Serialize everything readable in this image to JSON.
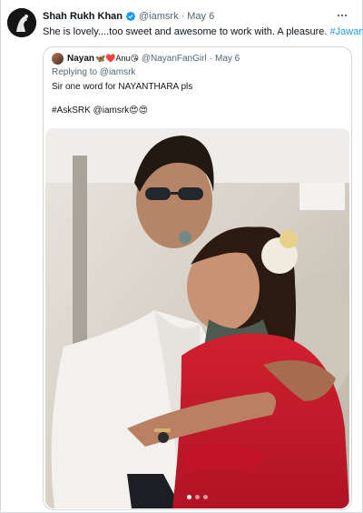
{
  "tweet": {
    "author_name": "Shah Rukh Khan",
    "author_handle": "@iamsrk",
    "separator": "·",
    "date": "May 6",
    "text": "She is lovely....too sweet and awesome to work with. A pleasure. ",
    "hashtag": "#Jawan",
    "more_icon": "more-horizontal-icon",
    "verified_icon": "verified-badge-icon"
  },
  "quoted": {
    "author_name": "Nayan",
    "author_emoji": "🦋❤️Anu😘",
    "author_handle": "@NayanFanGirl",
    "separator": "·",
    "date": "May 6",
    "replying_to": "Replying to @iamsrk",
    "body": "Sir one word for NAYANTHARA pls",
    "tags": "#AskSRK @iamsrk😍😍",
    "carousel": {
      "count": 3,
      "active": 1
    }
  },
  "colors": {
    "link": "#1d9bf0",
    "secondary_text": "#536471",
    "border": "#cfd9de",
    "verified": "#1d9bf0"
  }
}
